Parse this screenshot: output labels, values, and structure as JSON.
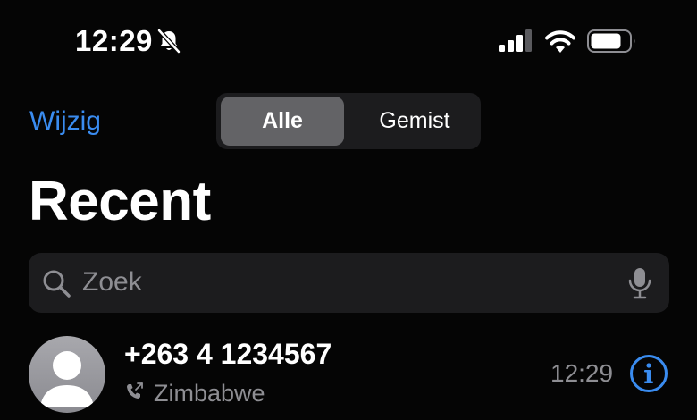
{
  "status_bar": {
    "time": "12:29",
    "icons": [
      "bell-slash-icon",
      "cellular-signal-icon",
      "wifi-icon",
      "battery-icon"
    ]
  },
  "nav": {
    "edit_label": "Wijzig",
    "segments": [
      {
        "label": "Alle",
        "selected": true
      },
      {
        "label": "Gemist",
        "selected": false
      }
    ]
  },
  "title": "Recent",
  "search": {
    "placeholder": "Zoek",
    "value": ""
  },
  "calls": [
    {
      "number": "+263 4 1234567",
      "country": "Zimbabwe",
      "time": "12:29",
      "call_icon": "outgoing-call-icon"
    }
  ],
  "colors": {
    "accent": "#3a8cf0",
    "background": "#050505",
    "secondary_text": "#8e8e93",
    "segment_bg": "#1c1c1e",
    "segment_selected": "#636366"
  }
}
